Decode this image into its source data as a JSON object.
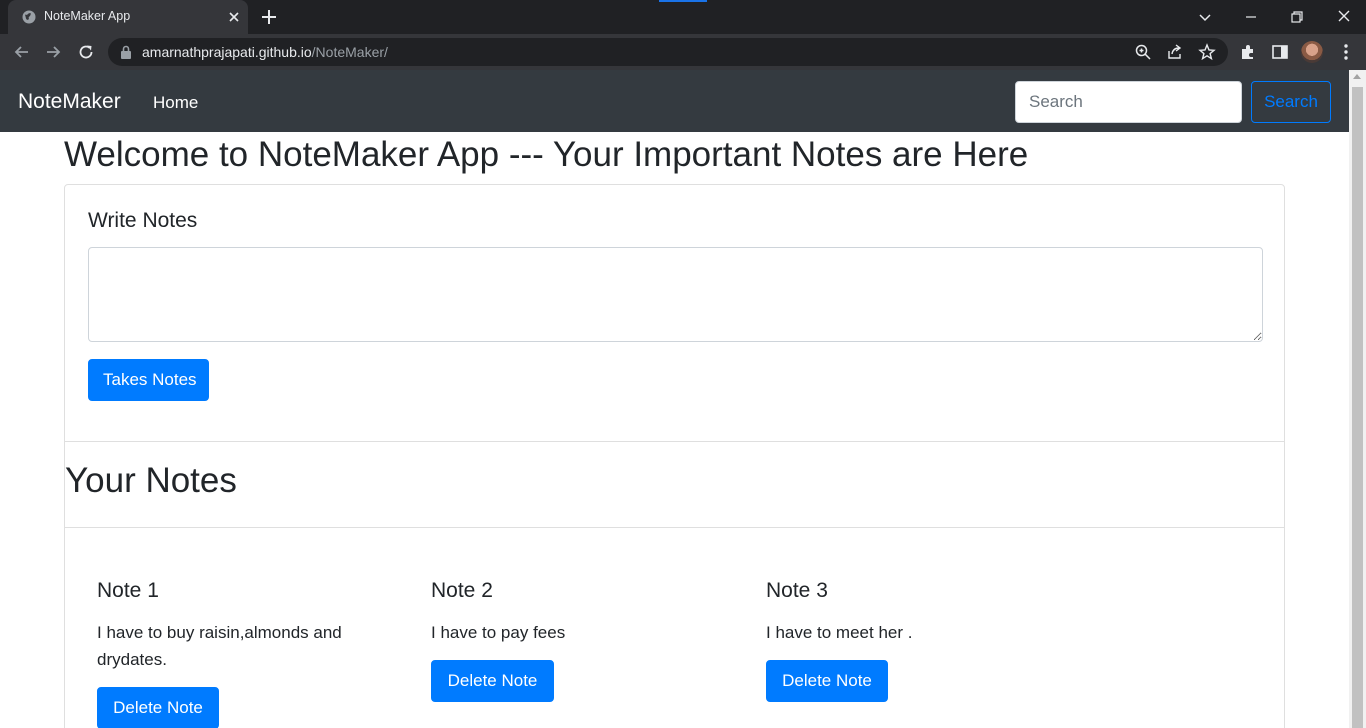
{
  "browser": {
    "tab_title": "NoteMaker App",
    "url_host": "amarnathprajapati.github.io",
    "url_path": "/NoteMaker/"
  },
  "navbar": {
    "brand": "NoteMaker",
    "home_link": "Home",
    "search_placeholder": "Search",
    "search_button": "Search"
  },
  "page": {
    "heading": "Welcome to NoteMaker App --- Your Important Notes are Here"
  },
  "composer": {
    "title": "Write Notes",
    "textarea_value": "",
    "submit_label": "Takes Notes"
  },
  "notes_section": {
    "heading": "Your Notes",
    "notes": [
      {
        "title": "Note 1",
        "text": "I have to buy raisin,almonds and drydates.",
        "delete_label": "Delete Note"
      },
      {
        "title": "Note 2",
        "text": "I have to pay fees",
        "delete_label": "Delete Note"
      },
      {
        "title": "Note 3",
        "text": "I have to meet her .",
        "delete_label": "Delete Note"
      }
    ]
  },
  "colors": {
    "navbar_bg": "#343a40",
    "primary": "#007bff",
    "chrome_dark": "#202124",
    "chrome_toolbar": "#35363a"
  }
}
